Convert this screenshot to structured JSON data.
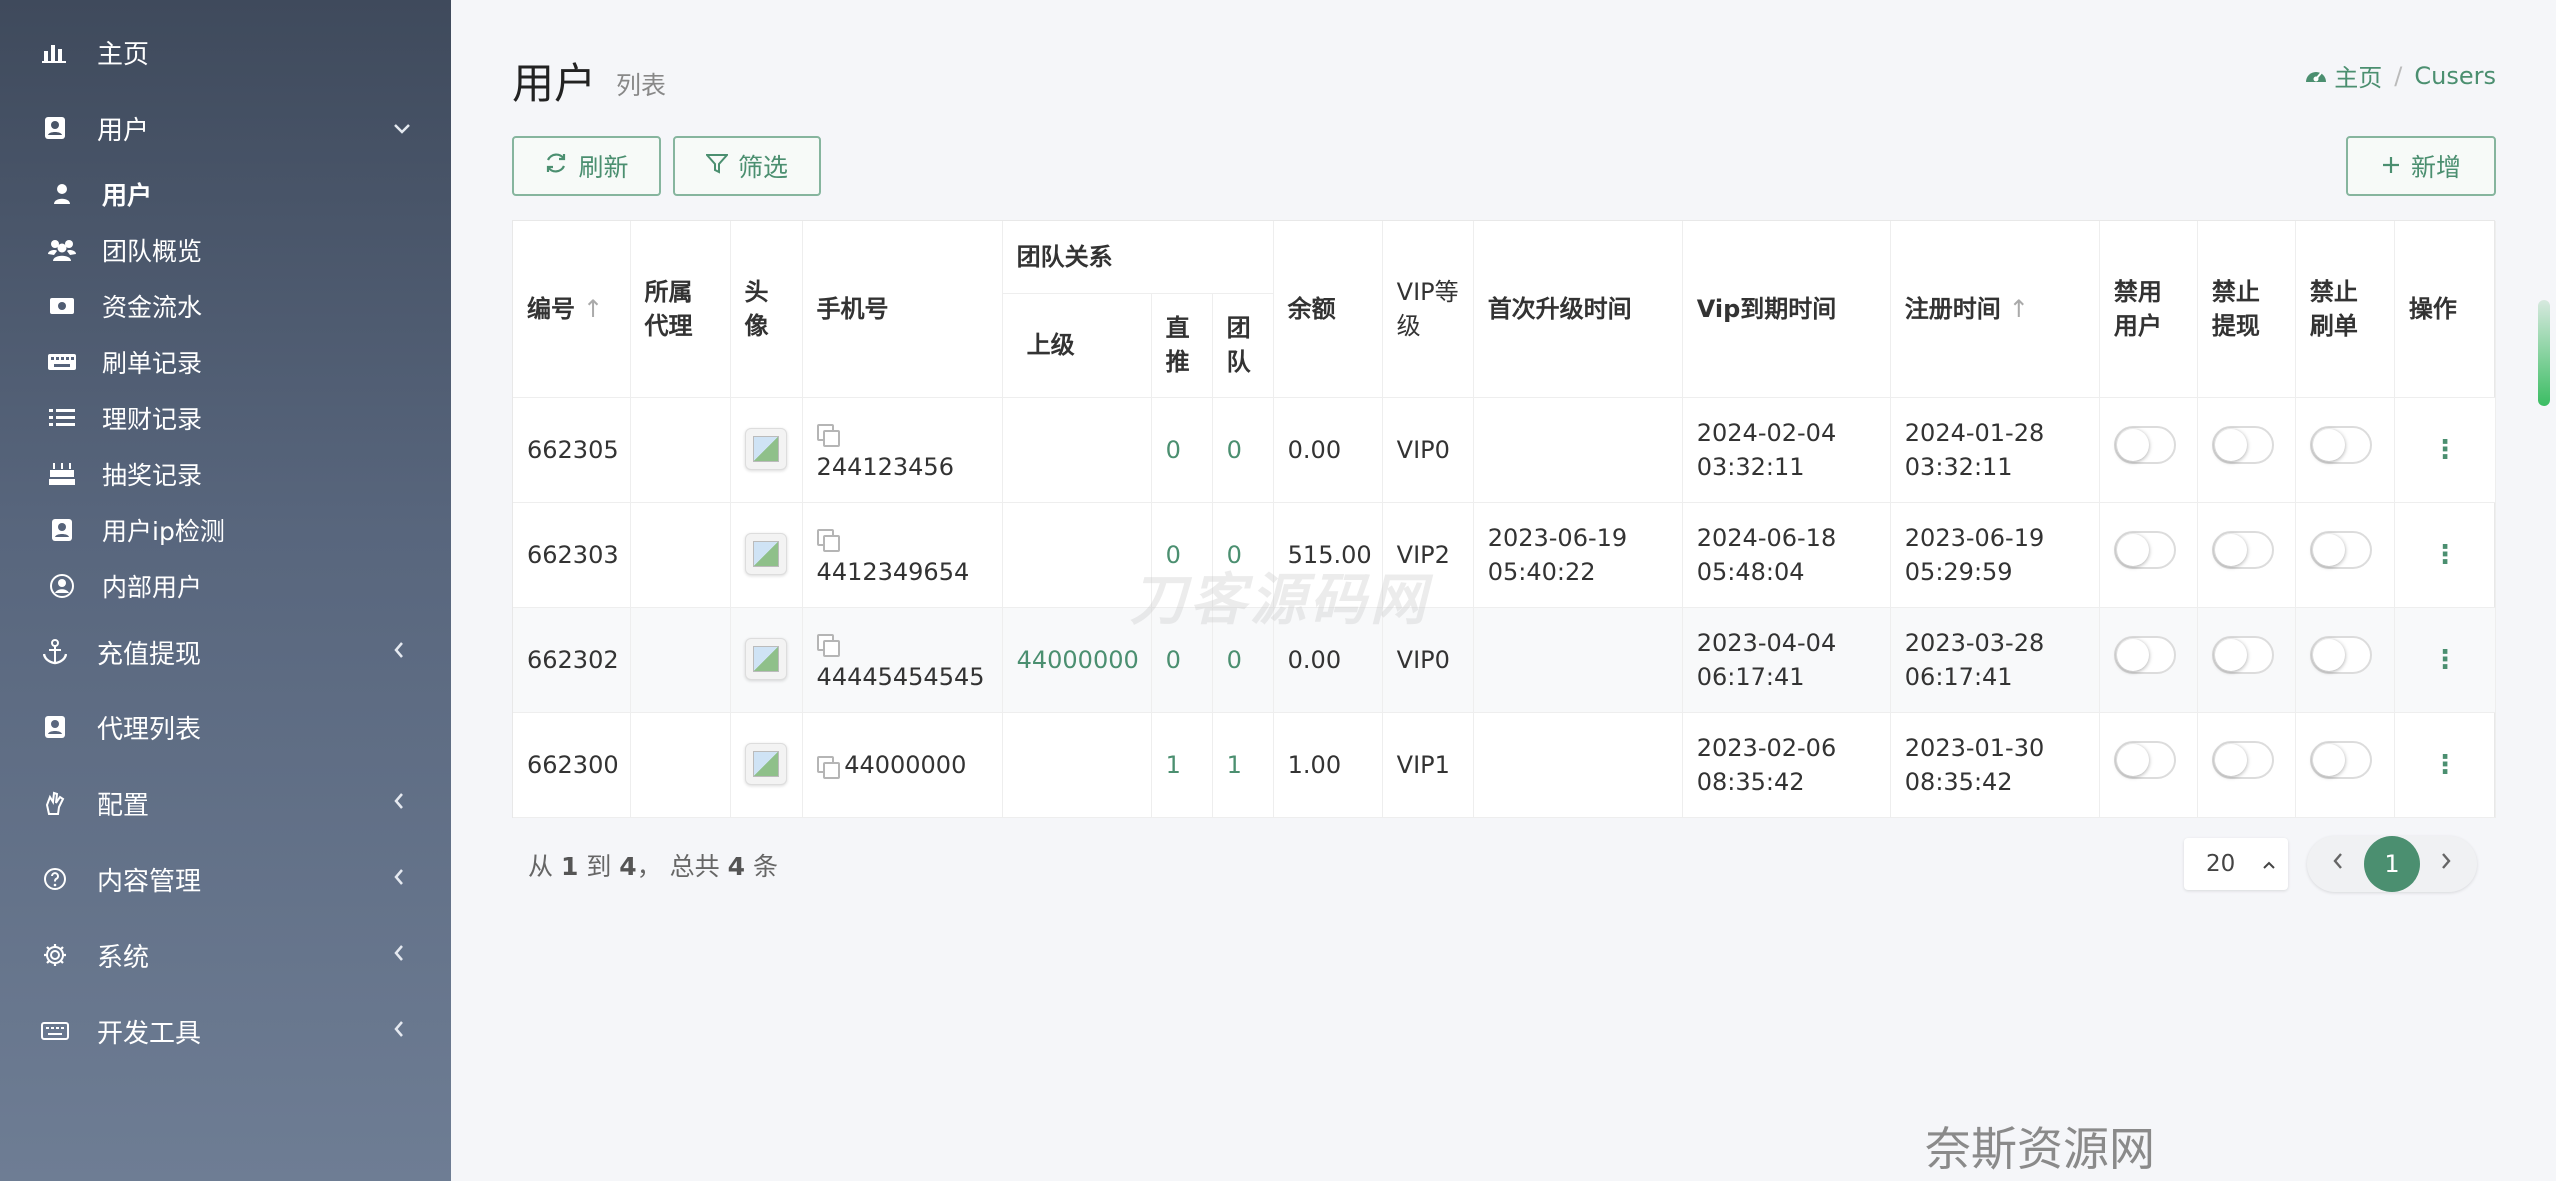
{
  "sidebar": {
    "home": {
      "label": "主页",
      "icon": "bar-chart-icon"
    },
    "users": {
      "label": "用户",
      "icon": "user-card-icon"
    },
    "users_children": [
      {
        "label": "用户",
        "icon": "user-icon"
      },
      {
        "label": "团队概览",
        "icon": "users-icon"
      },
      {
        "label": "资金流水",
        "icon": "money-icon"
      },
      {
        "label": "刷单记录",
        "icon": "keyboard-icon"
      },
      {
        "label": "理财记录",
        "icon": "list-icon"
      },
      {
        "label": "抽奖记录",
        "icon": "cake-icon"
      },
      {
        "label": "用户ip检测",
        "icon": "id-card-icon"
      },
      {
        "label": "内部用户",
        "icon": "user-circle-icon"
      }
    ],
    "recharge": {
      "label": "充值提现",
      "icon": "anchor-icon"
    },
    "agents": {
      "label": "代理列表",
      "icon": "user-card-icon"
    },
    "config": {
      "label": "配置",
      "icon": "hand-icon"
    },
    "content": {
      "label": "内容管理",
      "icon": "question-circle-icon"
    },
    "system": {
      "label": "系统",
      "icon": "gear-icon"
    },
    "devtools": {
      "label": "开发工具",
      "icon": "keyboard-icon"
    }
  },
  "header": {
    "title": "用户",
    "subtitle": "列表",
    "breadcrumb_home": "主页",
    "breadcrumb_current": "Cusers"
  },
  "toolbar": {
    "refresh": "刷新",
    "filter": "筛选",
    "add": "新增"
  },
  "table": {
    "headers": {
      "id": "编号",
      "agent": "所属代理",
      "avatar": "头像",
      "phone": "手机号",
      "team_group": "团队关系",
      "parent": "上级",
      "direct": "直推",
      "team": "团队",
      "balance": "余额",
      "vip": "VIP等级",
      "first_upgrade": "首次升级时间",
      "vip_expire": "Vip到期时间",
      "register": "注册时间",
      "ban_user": "禁用用户",
      "ban_withdraw": "禁止提现",
      "ban_order": "禁止刷单",
      "actions": "操作"
    },
    "rows": [
      {
        "id": "662305",
        "phone": "244123456",
        "parent": "",
        "direct": "0",
        "team": "0",
        "balance": "0.00",
        "vip": "VIP0",
        "first_upgrade_date": "",
        "first_upgrade_time": "",
        "vip_expire_date": "2024-02-04",
        "vip_expire_time": "03:32:11",
        "register_date": "2024-01-28",
        "register_time": "03:32:11"
      },
      {
        "id": "662303",
        "phone": "4412349654",
        "parent": "",
        "direct": "0",
        "team": "0",
        "balance": "515.00",
        "vip": "VIP2",
        "first_upgrade_date": "2023-06-19",
        "first_upgrade_time": "05:40:22",
        "vip_expire_date": "2024-06-18",
        "vip_expire_time": "05:48:04",
        "register_date": "2023-06-19",
        "register_time": "05:29:59"
      },
      {
        "id": "662302",
        "phone": "44445454545",
        "parent": "44000000",
        "direct": "0",
        "team": "0",
        "balance": "0.00",
        "vip": "VIP0",
        "first_upgrade_date": "",
        "first_upgrade_time": "",
        "vip_expire_date": "2023-04-04",
        "vip_expire_time": "06:17:41",
        "register_date": "2023-03-28",
        "register_time": "06:17:41"
      },
      {
        "id": "662300",
        "phone": "44000000",
        "parent": "",
        "direct": "1",
        "team": "1",
        "balance": "1.00",
        "vip": "VIP1",
        "first_upgrade_date": "",
        "first_upgrade_time": "",
        "vip_expire_date": "2023-02-06",
        "vip_expire_time": "08:35:42",
        "register_date": "2023-01-30",
        "register_time": "08:35:42"
      }
    ]
  },
  "pagination": {
    "summary_prefix": "从",
    "from": "1",
    "summary_to": "到",
    "to": "4",
    "summary_total": "， 总共",
    "total": "4",
    "summary_suffix": "条",
    "page_size": "20",
    "current_page": "1"
  },
  "watermarks": {
    "center": "刀客源码网",
    "bottom": "奈斯资源网www.nicezyw.com"
  },
  "colors": {
    "accent": "#4b8f70",
    "sidebar_top": "#3f4a5c",
    "sidebar_bottom": "#6e7d94"
  }
}
